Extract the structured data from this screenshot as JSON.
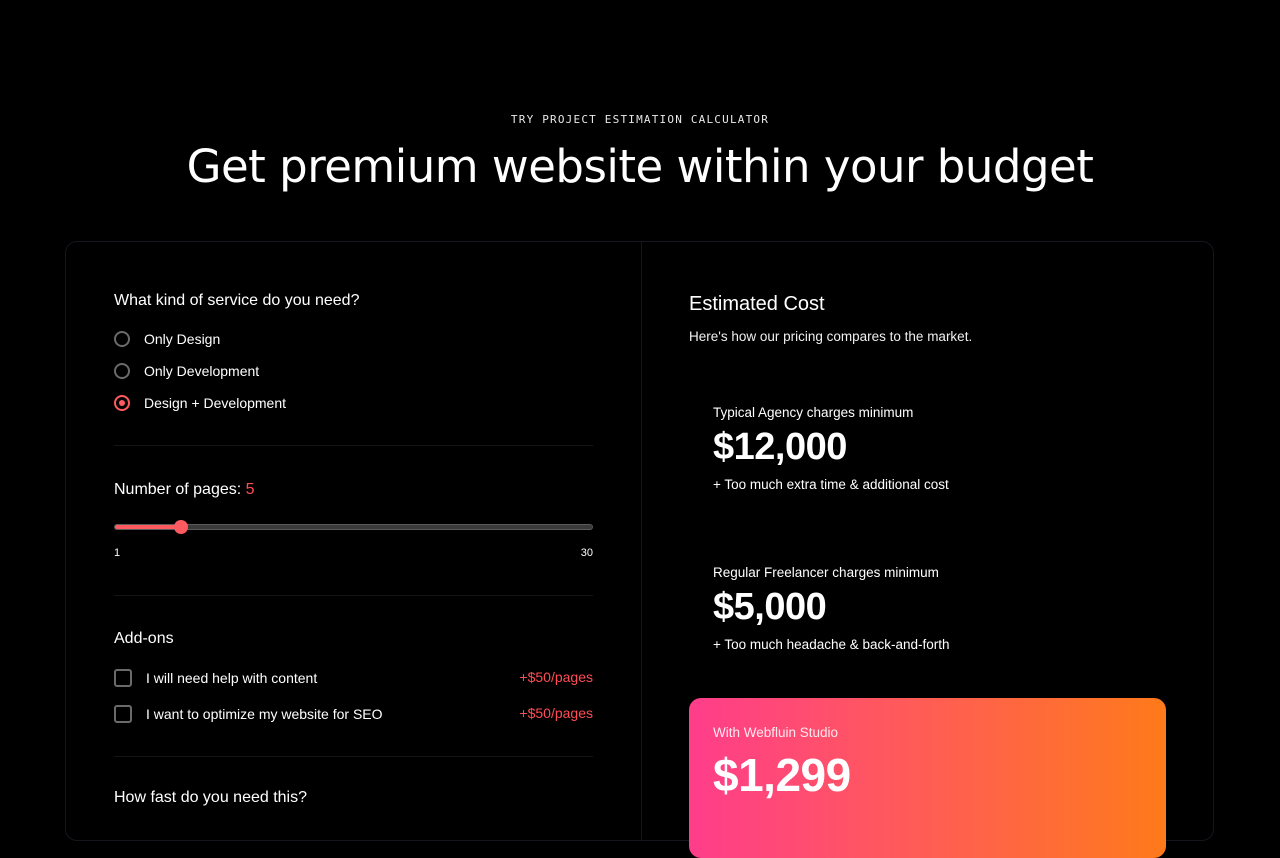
{
  "header": {
    "eyebrow": "TRY PROJECT ESTIMATION CALCULATOR",
    "title": "Get premium website within your budget"
  },
  "service": {
    "question": "What kind of service do you need?",
    "options": [
      {
        "label": "Only Design",
        "selected": false
      },
      {
        "label": "Only Development",
        "selected": false
      },
      {
        "label": "Design + Development",
        "selected": true
      }
    ]
  },
  "pages": {
    "label": "Number of pages:",
    "value": "5",
    "min": "1",
    "max": "30",
    "fraction": 0.1379
  },
  "addons": {
    "title": "Add-ons",
    "items": [
      {
        "label": "I will need help with content",
        "price": "+$50/pages",
        "checked": false
      },
      {
        "label": "I want to optimize my website for SEO",
        "price": "+$50/pages",
        "checked": false
      }
    ]
  },
  "speed": {
    "question": "How fast do you need this?"
  },
  "estimate": {
    "title": "Estimated Cost",
    "subtitle": "Here's how our pricing compares to the market.",
    "agency": {
      "label": "Typical Agency charges minimum",
      "price": "$12,000",
      "note": "+ Too much extra time & additional cost"
    },
    "freelancer": {
      "label": "Regular Freelancer charges minimum",
      "price": "$5,000",
      "note": "+ Too much headache & back-and-forth"
    },
    "studio": {
      "label": "With Webfluin Studio",
      "price": "$1,299"
    }
  },
  "colors": {
    "accent": "#ff5a5f",
    "gradient_start": "#ff3d8b",
    "gradient_end": "#ff7a1a"
  }
}
